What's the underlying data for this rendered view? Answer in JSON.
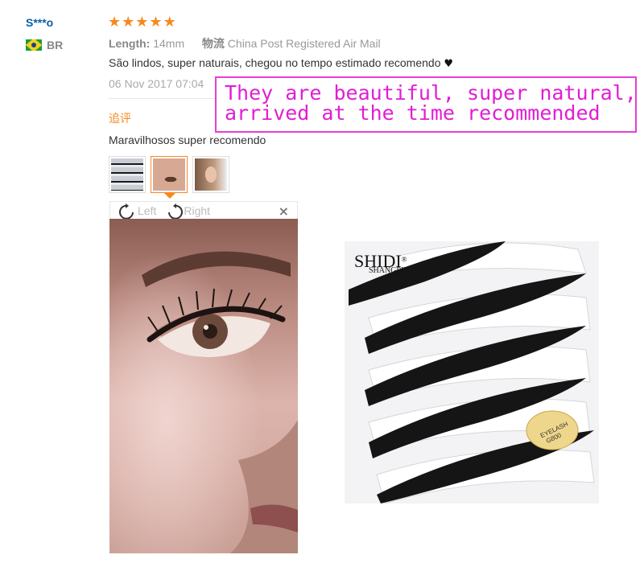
{
  "reviewer": {
    "name": "S***o",
    "country_code": "BR",
    "flag_icon": "brazil-flag-icon"
  },
  "rating": {
    "stars": 5,
    "max": 5,
    "star_glyph": "★",
    "color": "#f5891f"
  },
  "meta": {
    "length_label": "Length:",
    "length_value": "14mm",
    "shipping_label": "物流",
    "shipping_value": "China Post Registered Air Mail"
  },
  "review": {
    "text": "São lindos, super naturais, chegou no tempo estimado recomendo",
    "heart": "♥",
    "date": "06 Nov 2017 07:04"
  },
  "followup": {
    "label": "追评",
    "text": "Maravilhosos super recomendo"
  },
  "viewer": {
    "rotate_left_label": "Left",
    "rotate_right_label": "Right",
    "close_glyph": "×"
  },
  "product_image": {
    "brand_line1": "SHIDI",
    "brand_line2": "SHANGPIN",
    "registered": "®",
    "sticker_line1": "EYELASH",
    "sticker_line2": "G800"
  },
  "callout": {
    "line1": "They are beautiful, super natural,",
    "line2": "arrived at the time recommended",
    "color": "#e01ed6"
  }
}
